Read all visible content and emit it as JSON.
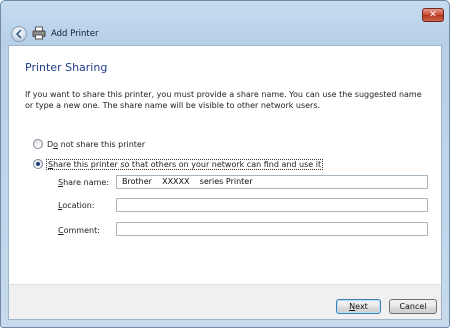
{
  "window": {
    "title": "Add Printer",
    "close_glyph": "✕",
    "back_icon": "back-arrow-icon",
    "title_icon": "printer-icon"
  },
  "page": {
    "heading": "Printer Sharing",
    "description": "If you want to share this printer, you must provide a share name. You can use the suggested name or type a new one. The share name will be visible to other network users."
  },
  "options": [
    {
      "access_key": "o",
      "label_prefix": "D",
      "label_rest": " not share this printer",
      "checked": false
    },
    {
      "access_key": "S",
      "label_prefix": "",
      "label_rest": "hare this printer so that others on your network can find and use it",
      "checked": true
    }
  ],
  "fields": {
    "share_name": {
      "access_key": "S",
      "label_rest": "hare name:",
      "value": "Brother    XXXXX    series Printer"
    },
    "location": {
      "access_key": "L",
      "label_rest": "ocation:",
      "value": ""
    },
    "comment": {
      "access_key": "C",
      "label_rest": "omment:",
      "value": ""
    }
  },
  "footer": {
    "next_key": "N",
    "next_rest": "ext",
    "cancel_label": "Cancel"
  }
}
